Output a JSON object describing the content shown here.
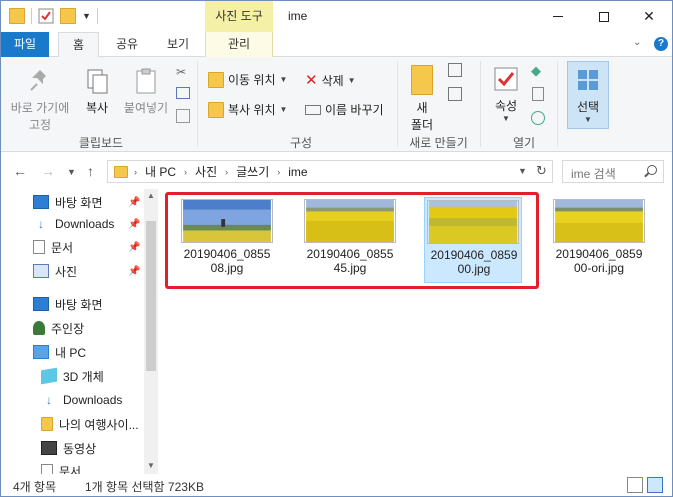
{
  "window": {
    "title": "ime"
  },
  "context_tab_group": "사진 도구",
  "tabs": {
    "file": "파일",
    "home": "홈",
    "share": "공유",
    "view": "보기",
    "manage": "관리"
  },
  "ribbon": {
    "clipboard": {
      "pin": "바로 가기에\n고정",
      "pin_line1": "바로 가기에",
      "pin_line2": "고정",
      "copy": "복사",
      "paste": "붙여넣기",
      "label": "클립보드"
    },
    "organize": {
      "move_to": "이동 위치",
      "copy_to": "복사 위치",
      "delete": "삭제",
      "rename": "이름 바꾸기",
      "label": "구성"
    },
    "new": {
      "new_folder_line1": "새",
      "new_folder_line2": "폴더",
      "label": "새로 만들기"
    },
    "open": {
      "properties": "속성",
      "label": "열기"
    },
    "select": {
      "select": "선택"
    }
  },
  "address": {
    "crumbs": [
      "내 PC",
      "사진",
      "글쓰기",
      "ime"
    ]
  },
  "search": {
    "placeholder": "ime 검색"
  },
  "nav_pane": {
    "quick": [
      {
        "label": "바탕 화면",
        "icon": "desktop-icon"
      },
      {
        "label": "Downloads",
        "icon": "downloads-icon"
      },
      {
        "label": "문서",
        "icon": "documents-icon"
      },
      {
        "label": "사진",
        "icon": "pictures-icon"
      }
    ],
    "tree": [
      {
        "label": "바탕 화면",
        "icon": "desktop-icon"
      },
      {
        "label": "주인장",
        "icon": "user-icon"
      },
      {
        "label": "내 PC",
        "icon": "computer-icon"
      },
      {
        "label": "3D 개체",
        "icon": "3d-objects-icon"
      },
      {
        "label": "Downloads",
        "icon": "downloads-icon"
      },
      {
        "label": "나의 여행사이...",
        "icon": "folder-icon"
      },
      {
        "label": "동영상",
        "icon": "videos-icon"
      },
      {
        "label": "문서",
        "icon": "documents-icon"
      }
    ]
  },
  "files": [
    {
      "name": "20190406_085508.jpg",
      "line1": "20190406_0855",
      "line2": "08.jpg",
      "selected": false
    },
    {
      "name": "20190406_085545.jpg",
      "line1": "20190406_0855",
      "line2": "45.jpg",
      "selected": false
    },
    {
      "name": "20190406_085900.jpg",
      "line1": "20190406_0859",
      "line2": "00.jpg",
      "selected": true
    },
    {
      "name": "20190406_085900-ori.jpg",
      "line1": "20190406_0859",
      "line2": "00-ori.jpg",
      "selected": false
    }
  ],
  "status": {
    "count": "4개 항목",
    "selection": "1개 항목 선택함 723KB"
  },
  "colors": {
    "accent": "#1979ca",
    "highlight": "#e0202a",
    "selected_bg": "#cce8ff"
  }
}
